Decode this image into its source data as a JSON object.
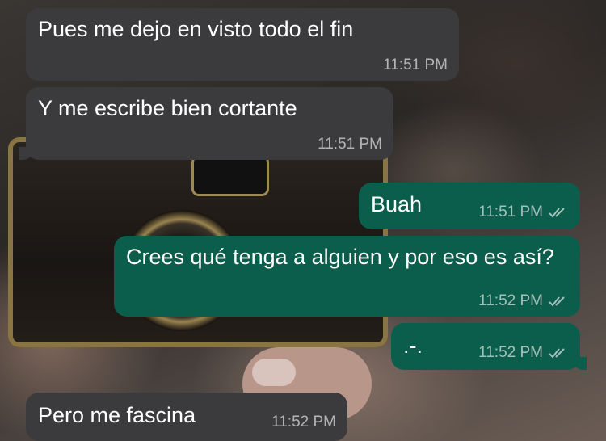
{
  "chat": {
    "messages": [
      {
        "direction": "incoming",
        "text": "Pues me dejo en visto todo el fin",
        "time": "11:51 PM"
      },
      {
        "direction": "incoming",
        "text": "Y me escribe bien cortante",
        "time": "11:51 PM"
      },
      {
        "direction": "outgoing",
        "text": "Buah",
        "time": "11:51 PM",
        "status_icon": "double-check-icon"
      },
      {
        "direction": "outgoing",
        "text": "Crees qué tenga a alguien y por eso es así?",
        "time": "11:52 PM",
        "status_icon": "double-check-icon"
      },
      {
        "direction": "outgoing",
        "text": ".-.",
        "time": "11:52 PM",
        "status_icon": "double-check-icon"
      },
      {
        "direction": "incoming",
        "text": "Pero me fascina",
        "time": "11:52 PM"
      }
    ]
  },
  "colors": {
    "incoming_bubble": "#3b3b3d",
    "outgoing_bubble": "#0b5d4c",
    "text": "#ffffff",
    "meta_text": "#a8a8a8"
  }
}
